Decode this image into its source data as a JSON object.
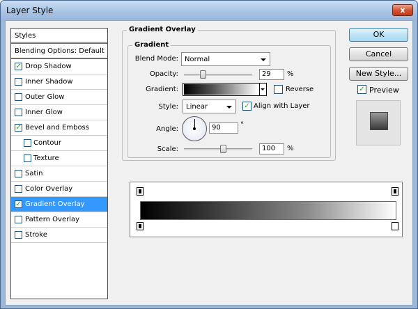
{
  "window": {
    "title": "Layer Style",
    "close_label": "x"
  },
  "styles_list": [
    {
      "label": "Styles",
      "kind": "header",
      "checked": null
    },
    {
      "label": "Blending Options: Default",
      "kind": "header",
      "checked": null
    },
    {
      "label": "Drop Shadow",
      "kind": "item",
      "checked": true
    },
    {
      "label": "Inner Shadow",
      "kind": "item",
      "checked": false
    },
    {
      "label": "Outer Glow",
      "kind": "item",
      "checked": false
    },
    {
      "label": "Inner Glow",
      "kind": "item",
      "checked": false
    },
    {
      "label": "Bevel and Emboss",
      "kind": "item",
      "checked": true
    },
    {
      "label": "Contour",
      "kind": "sub",
      "checked": false
    },
    {
      "label": "Texture",
      "kind": "sub",
      "checked": false
    },
    {
      "label": "Satin",
      "kind": "item",
      "checked": false
    },
    {
      "label": "Color Overlay",
      "kind": "item",
      "checked": false
    },
    {
      "label": "Gradient Overlay",
      "kind": "item",
      "checked": true,
      "selected": true
    },
    {
      "label": "Pattern Overlay",
      "kind": "item",
      "checked": false
    },
    {
      "label": "Stroke",
      "kind": "item",
      "checked": false
    }
  ],
  "panel": {
    "title": "Gradient Overlay",
    "group": "Gradient",
    "blend_mode": {
      "label": "Blend Mode:",
      "value": "Normal"
    },
    "opacity": {
      "label": "Opacity:",
      "value": "29",
      "unit": "%",
      "fraction": 0.29
    },
    "gradient": {
      "label": "Gradient:"
    },
    "reverse": {
      "label": "Reverse",
      "checked": false
    },
    "style": {
      "label": "Style:",
      "value": "Linear"
    },
    "align_with_layer": {
      "label": "Align with Layer",
      "checked": true
    },
    "angle": {
      "label": "Angle:",
      "value": "90",
      "unit": "°"
    },
    "scale": {
      "label": "Scale:",
      "value": "100",
      "unit": "%",
      "fraction": 0.58
    }
  },
  "buttons": {
    "ok": "OK",
    "cancel": "Cancel",
    "new_style": "New Style..."
  },
  "preview": {
    "label": "Preview",
    "checked": true
  },
  "check_mark": "✓"
}
